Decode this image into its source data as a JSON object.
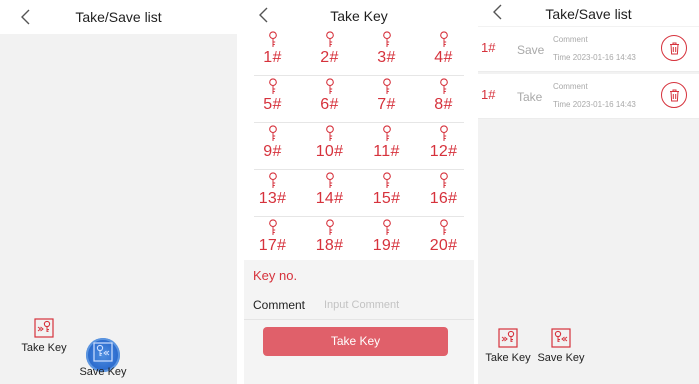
{
  "screen1": {
    "title": "Take/Save list",
    "take_key_label": "Take Key",
    "save_key_label": "Save Key"
  },
  "screen2": {
    "title": "Take Key",
    "keys": [
      "1#",
      "2#",
      "3#",
      "4#",
      "5#",
      "6#",
      "7#",
      "8#",
      "9#",
      "10#",
      "11#",
      "12#",
      "13#",
      "14#",
      "15#",
      "16#",
      "17#",
      "18#",
      "19#",
      "20#"
    ],
    "key_no_label": "Key no.",
    "comment_label": "Comment",
    "comment_placeholder": "Input Comment",
    "comment_value": "",
    "take_button": "Take Key"
  },
  "screen3": {
    "title": "Take/Save list",
    "records": [
      {
        "key": "1#",
        "type": "Save",
        "comment": "Comment",
        "time": "Time 2023-01-16 14:43"
      },
      {
        "key": "1#",
        "type": "Take",
        "comment": "Comment",
        "time": "Time 2023-01-16 14:43"
      }
    ],
    "take_key_label": "Take Key",
    "save_key_label": "Save Key"
  },
  "colors": {
    "accent": "#d6323c",
    "button": "#e0606a",
    "highlight": "#2f6fd0"
  },
  "icons": [
    "back-chevron-icon",
    "take-key-icon",
    "save-key-icon",
    "key-icon",
    "trash-icon"
  ]
}
